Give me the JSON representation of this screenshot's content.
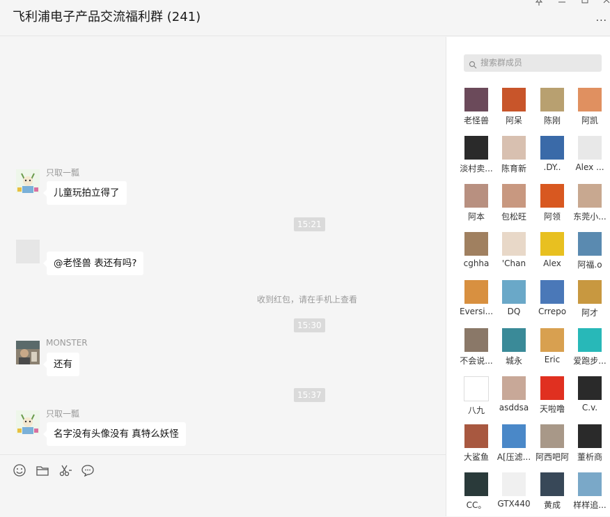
{
  "window": {
    "title": "飞利浦电子产品交流福利群 (241)",
    "buttons": [
      "pin-icon",
      "minimize-icon",
      "maximize-icon",
      "close-icon"
    ],
    "more_label": "···"
  },
  "chat": {
    "messages": [
      {
        "sender": "只取一瓢",
        "text": "儿童玩拍立得了",
        "avatar": "cartoon-avatar"
      },
      {
        "time": "15:21"
      },
      {
        "sender": "",
        "text": "@老怪兽 表还有吗?",
        "avatar": "blank-avatar"
      },
      {
        "system": "收到红包，请在手机上查看"
      },
      {
        "time": "15:30"
      },
      {
        "sender": "MONSTER",
        "text": "还有",
        "avatar": "photo-avatar"
      },
      {
        "time": "15:37"
      },
      {
        "sender": "只取一瓢",
        "text": "名字没有头像没有  真特么妖怪",
        "avatar": "cartoon-avatar"
      }
    ]
  },
  "toolbar": {
    "icons": [
      "emoji-icon",
      "folder-icon",
      "scissors-icon",
      "chat-history-icon"
    ]
  },
  "sidebar": {
    "search_placeholder": "搜索群成员",
    "members": [
      {
        "name": "老怪兽",
        "color": "#6b4a5a"
      },
      {
        "name": "阿呆",
        "color": "#c8552a"
      },
      {
        "name": "陈刚",
        "color": "#b8a070"
      },
      {
        "name": "阿凯",
        "color": "#e09060"
      },
      {
        "name": "淡村卖...",
        "color": "#2a2a2a"
      },
      {
        "name": "陈育新",
        "color": "#d8c0b0"
      },
      {
        "name": ".DY..",
        "color": "#3a6aa8"
      },
      {
        "name": "Alex ...",
        "color": "#e8e8e8"
      },
      {
        "name": "阿本",
        "color": "#b89080"
      },
      {
        "name": "包松旺",
        "color": "#c89880"
      },
      {
        "name": "阿领",
        "color": "#d85820"
      },
      {
        "name": "东莞小...",
        "color": "#c8a890"
      },
      {
        "name": "cghha",
        "color": "#a08060"
      },
      {
        "name": "'Chan",
        "color": "#e8d8c8"
      },
      {
        "name": "Alex",
        "color": "#e8c020"
      },
      {
        "name": "阿福.o",
        "color": "#5a8ab0"
      },
      {
        "name": "Eversi...",
        "color": "#d89040"
      },
      {
        "name": "DQ",
        "color": "#6aa8c8"
      },
      {
        "name": "Crrepo",
        "color": "#4a78b8"
      },
      {
        "name": "阿才",
        "color": "#c89840"
      },
      {
        "name": "不会说...",
        "color": "#8a7868"
      },
      {
        "name": "城永",
        "color": "#3a8a98"
      },
      {
        "name": "Eric",
        "color": "#d8a050"
      },
      {
        "name": "爱跑步...",
        "color": "#28b8b8"
      },
      {
        "name": "八九",
        "color": "#ffffff"
      },
      {
        "name": "asddsa",
        "color": "#c8a898"
      },
      {
        "name": "天啦噜",
        "color": "#e03020"
      },
      {
        "name": "C.v.",
        "color": "#2a2a2a"
      },
      {
        "name": "大鲨鱼",
        "color": "#a85840"
      },
      {
        "name": "A[压滤...",
        "color": "#4a88c8"
      },
      {
        "name": "阿西吧阿",
        "color": "#a89888"
      },
      {
        "name": "董析商",
        "color": "#2a2a2a"
      },
      {
        "name": "CC。",
        "color": "#2a3a3a"
      },
      {
        "name": "GTX440",
        "color": "#f0f0f0"
      },
      {
        "name": "黄成",
        "color": "#384858"
      },
      {
        "name": "样样追...",
        "color": "#7aa8c8"
      }
    ]
  }
}
